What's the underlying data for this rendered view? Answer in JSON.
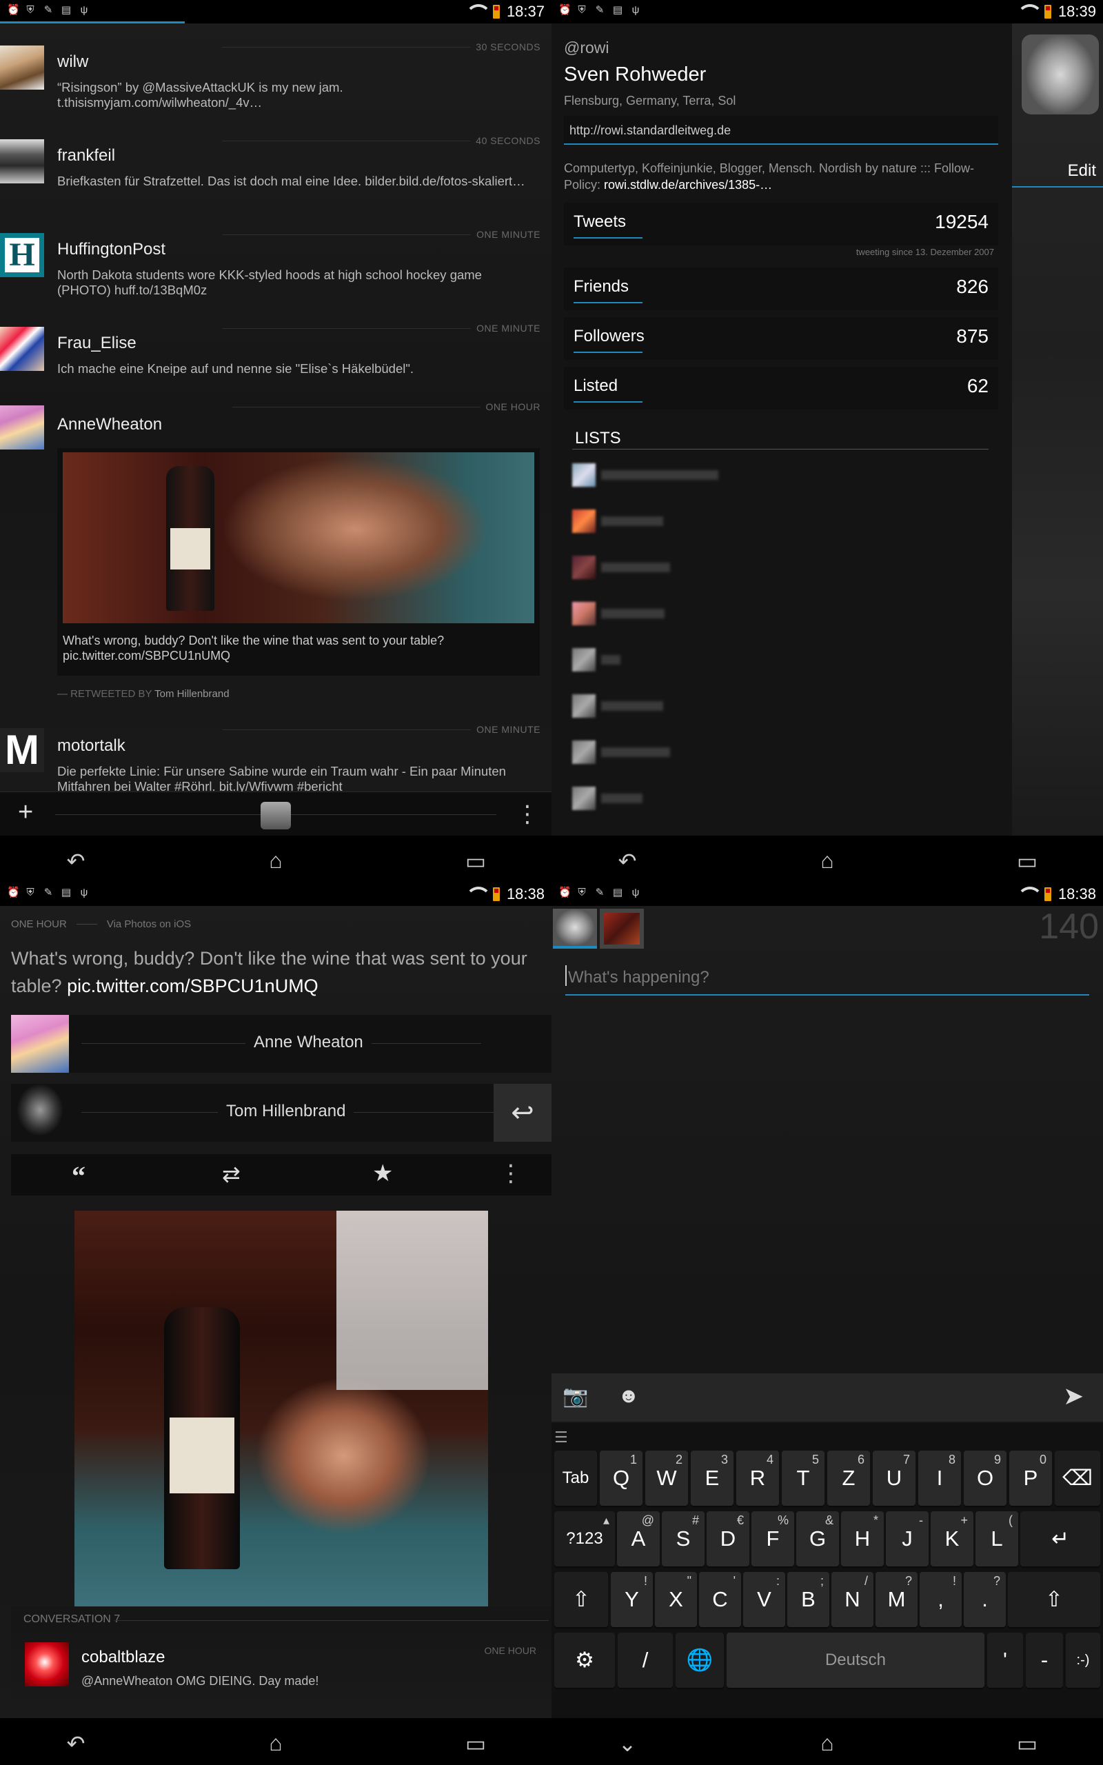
{
  "status_bar": {
    "q1_time": "18:37",
    "q2_time": "18:39",
    "q3_time": "18:38",
    "q4_time": "18:38"
  },
  "timeline": {
    "tweets": [
      {
        "user": "wilw",
        "time": "30 SECONDS",
        "text": "“Risingson” by @MassiveAttackUK is my new jam. t.thisismyjam.com/wilwheaton/_4v…"
      },
      {
        "user": "frankfeil",
        "time": "40 SECONDS",
        "text": "Briefkasten für Strafzettel. Das ist doch mal eine Idee. bilder.bild.de/fotos-skaliert…"
      },
      {
        "user": "HuffingtonPost",
        "time": "ONE MINUTE",
        "text": "North Dakota students wore KKK-styled hoods at high school hockey game (PHOTO) huff.to/13BqM0z"
      },
      {
        "user": "Frau_Elise",
        "time": "ONE MINUTE",
        "text": "Ich mache eine Kneipe auf und nenne sie \"Elise`s Häkelbüdel\"."
      },
      {
        "user": "AnneWheaton",
        "time": "ONE HOUR",
        "text": "What's wrong, buddy? Don't like the wine that was sent to your table? pic.twitter.com/SBPCU1nUMQ",
        "retweet_prefix": "— RETWEETED BY",
        "retweeted_by": "Tom Hillenbrand"
      },
      {
        "user": "motortalk",
        "time": "ONE MINUTE",
        "text": "Die perfekte Linie: Für unsere Sabine wurde ein Traum wahr - Ein paar Minuten Mitfahren bei Walter #Röhrl. bit.ly/Wfivwm #bericht"
      }
    ],
    "hu_letter": "H",
    "mt_letter": "M",
    "add_label": "+",
    "menu_label": "⋮"
  },
  "profile": {
    "handle": "@rowi",
    "name": "Sven Rohweder",
    "location": "Flensburg, Germany, Terra, Sol",
    "url": "http://rowi.standardleitweg.de",
    "bio": "Computertyp, Koffeinjunkie, Blogger, Mensch. Nordish by nature ::: Follow-Policy:",
    "bio_link": "rowi.stdlw.de/archives/1385-…",
    "edit_label": "Edit",
    "stats": [
      {
        "label": "Tweets",
        "value": "19254"
      },
      {
        "label": "Friends",
        "value": "826"
      },
      {
        "label": "Followers",
        "value": "875"
      },
      {
        "label": "Listed",
        "value": "62"
      }
    ],
    "tweeting_since": "tweeting since 13. Dezember 2007",
    "lists_header": "LISTS"
  },
  "detail": {
    "time": "ONE HOUR",
    "via": "Via Photos on iOS",
    "text": "What's wrong, buddy? Don't like the wine that was sent to your table?",
    "link": "pic.twitter.com/SBPCU1nUMQ",
    "author": "Anne Wheaton",
    "retweeter": "Tom Hillenbrand",
    "conversation_label": "CONVERSATION",
    "conversation_count": "7",
    "reply_user": "cobaltblaze",
    "reply_time": "ONE HOUR",
    "reply_text": "@AnneWheaton OMG DIEING. Day made!"
  },
  "compose": {
    "counter": "140",
    "placeholder": "What's happening?",
    "keyboard": {
      "row1": [
        [
          "Tab",
          ""
        ],
        [
          "Q",
          "1"
        ],
        [
          "W",
          "2"
        ],
        [
          "E",
          "3"
        ],
        [
          "R",
          "4"
        ],
        [
          "T",
          "5"
        ],
        [
          "Z",
          "6"
        ],
        [
          "U",
          "7"
        ],
        [
          "I",
          "8"
        ],
        [
          "O",
          "9"
        ],
        [
          "P",
          "0"
        ]
      ],
      "row2": [
        [
          "?123",
          "▴"
        ],
        [
          "A",
          "@"
        ],
        [
          "S",
          "#"
        ],
        [
          "D",
          "€"
        ],
        [
          "F",
          "%"
        ],
        [
          "G",
          "&"
        ],
        [
          "H",
          "*"
        ],
        [
          "J",
          "-"
        ],
        [
          "K",
          "+"
        ],
        [
          "L",
          "("
        ]
      ],
      "row3": [
        [
          "Y",
          "!"
        ],
        [
          "X",
          "\""
        ],
        [
          "C",
          "'"
        ],
        [
          "V",
          ":"
        ],
        [
          "B",
          ";"
        ],
        [
          "N",
          "/"
        ],
        [
          "M",
          "?"
        ],
        [
          ",",
          "!"
        ],
        [
          ".",
          "?"
        ]
      ],
      "space": "Deutsch",
      "smiley": ":-)",
      "smiley_sub": ":-)"
    }
  },
  "colors": {
    "accent": "#1e8ac0",
    "bg": "#141414"
  }
}
